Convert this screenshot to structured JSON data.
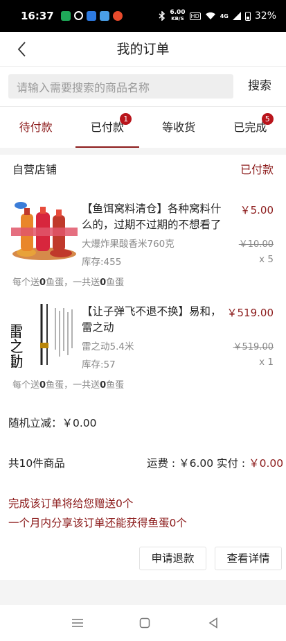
{
  "status_bar": {
    "time": "16:37",
    "net_speed_top": "6.00",
    "net_speed_bottom": "KB/S",
    "hd_label": "HD",
    "signal_label": "4G",
    "battery": "32%"
  },
  "nav": {
    "title": "我的订单"
  },
  "search": {
    "placeholder": "请输入需要搜索的商品名称",
    "button_label": "搜索"
  },
  "tabs": [
    {
      "label": "待付款",
      "badge": ""
    },
    {
      "label": "已付款",
      "badge": "1"
    },
    {
      "label": "等收货",
      "badge": ""
    },
    {
      "label": "已完成",
      "badge": "5"
    }
  ],
  "order": {
    "shop_name": "自营店铺",
    "status": "已付款",
    "products": [
      {
        "title": "【鱼饵窝料清仓】各种窝料什么的，过期不过期的不想看了",
        "price": "￥5.00",
        "spec": "大爆炸果酸香米760克",
        "original_price": "￥10.00",
        "stock": "库存:455",
        "quantity": "x 5",
        "gift_prefix": "每个送",
        "gift_each": "0",
        "gift_middle": "鱼蛋，一共送",
        "gift_total": "0",
        "gift_suffix": "鱼蛋"
      },
      {
        "title": "【让子弹飞不退不换】易和，雷之动",
        "price": "￥519.00",
        "spec": "雷之动5.4米",
        "original_price": "￥519.00",
        "stock": "库存:57",
        "quantity": "x 1",
        "gift_prefix": "每个送",
        "gift_each": "0",
        "gift_middle": "鱼蛋，一共送",
        "gift_total": "0",
        "gift_suffix": "鱼蛋"
      }
    ],
    "discount_label": "随机立减：",
    "discount_value": "￥0.00",
    "total_count": "共10件商品",
    "shipping_label": "运费 : ",
    "shipping_value": "￥6.00",
    "paid_label": "实付 : ",
    "paid_value": "￥0.00",
    "promo_line1": "完成该订单将给您赠送0个",
    "promo_line2": "一个月内分享该订单还能获得鱼蛋0个",
    "refund_button": "申请退款",
    "detail_button": "查看详情",
    "product2_image_text": "雷之動"
  },
  "colors": {
    "accent": "#8b1a1a",
    "badge": "#b9151c",
    "muted": "#888888",
    "search_bg": "#eeeeee"
  }
}
